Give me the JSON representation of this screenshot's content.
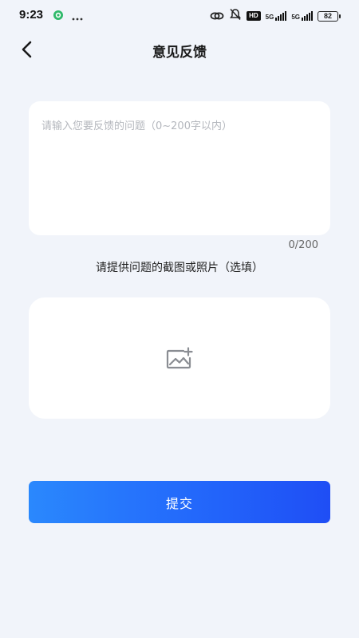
{
  "status_bar": {
    "time": "9:23",
    "hd_label": "HD",
    "network1_label": "5G",
    "network2_label": "5G",
    "battery": "82"
  },
  "header": {
    "title": "意见反馈"
  },
  "feedback": {
    "placeholder": "请输入您要反馈的问题（0~200字以内）",
    "value": "",
    "counter": "0/200"
  },
  "photo": {
    "hint": "请提供问题的截图或照片（选填）"
  },
  "submit": {
    "label": "提交"
  },
  "icons": {
    "back": "back-arrow-icon",
    "add_image": "add-image-icon"
  }
}
